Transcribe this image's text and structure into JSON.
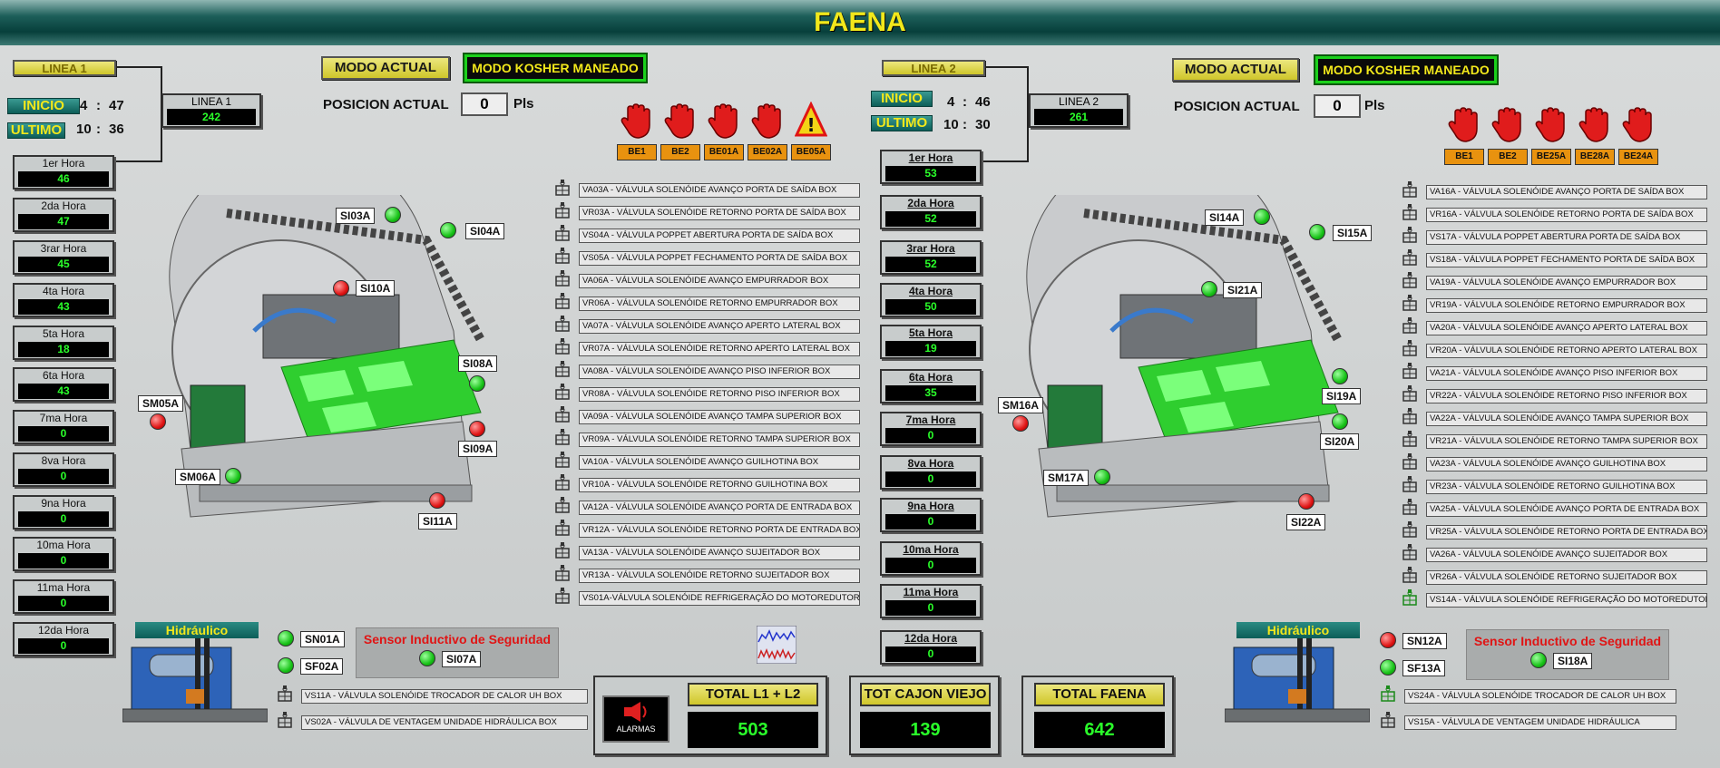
{
  "header": {
    "title": "FAENA"
  },
  "line1": {
    "tag": "LINEA 1",
    "inicio_label": "INICIO",
    "inicio_h": "4",
    "inicio_m": "47",
    "ultimo_label": "ULTIMO",
    "ultimo_h": "10",
    "ultimo_m": "36",
    "linebox": {
      "label": "LINEA 1",
      "value": "242"
    },
    "mode_label": "MODO ACTUAL",
    "mode_value": "MODO KOSHER MANEADO",
    "pos_label": "POSICION ACTUAL",
    "pos_value": "0",
    "pos_unit": "Pls",
    "be_buttons": [
      "BE1",
      "BE2",
      "BE01A",
      "BE02A",
      "BE05A"
    ],
    "hours": [
      {
        "label": "1er Hora",
        "value": "46"
      },
      {
        "label": "2da Hora",
        "value": "47"
      },
      {
        "label": "3rar Hora",
        "value": "45"
      },
      {
        "label": "4ta Hora",
        "value": "43"
      },
      {
        "label": "5ta Hora",
        "value": "18"
      },
      {
        "label": "6ta Hora",
        "value": "43"
      },
      {
        "label": "7ma  Hora",
        "value": "0"
      },
      {
        "label": "8va Hora",
        "value": "0"
      },
      {
        "label": "9na Hora",
        "value": "0"
      },
      {
        "label": "10ma Hora",
        "value": "0"
      },
      {
        "label": "11ma Hora",
        "value": "0"
      },
      {
        "label": "12da Hora",
        "value": "0"
      }
    ],
    "sensors": {
      "si03a": "SI03A",
      "si04a": "SI04A",
      "si10a": "SI10A",
      "si08a": "SI08A",
      "sm05a": "SM05A",
      "si09a": "SI09A",
      "sm06a": "SM06A",
      "si11a": "SI11A"
    },
    "valves": [
      "VA03A - VÁLVULA SOLENÓIDE AVANÇO PORTA DE SAÍDA BOX",
      "VR03A - VÁLVULA SOLENÓIDE RETORNO PORTA DE SAÍDA BOX",
      "VS04A - VÁLVULA POPPET ABERTURA PORTA DE SAÍDA BOX",
      "VS05A - VÁLVULA POPPET FECHAMENTO PORTA DE SAÍDA BOX",
      "VA06A - VÁLVULA SOLENÓIDE AVANÇO EMPURRADOR BOX",
      "VR06A - VÁLVULA SOLENÓIDE RETORNO EMPURRADOR BOX",
      "VA07A - VÁLVULA SOLENÓIDE AVANÇO APERTO LATERAL BOX",
      "VR07A - VÁLVULA SOLENÓIDE RETORNO APERTO LATERAL BOX",
      "VA08A - VÁLVULA SOLENÓIDE AVANÇO PISO INFERIOR BOX",
      "VR08A - VÁLVULA SOLENÓIDE RETORNO PISO INFERIOR BOX",
      "VA09A - VÁLVULA SOLENÓIDE AVANÇO TAMPA SUPERIOR BOX",
      "VR09A - VÁLVULA SOLENÓIDE RETORNO TAMPA SUPERIOR BOX",
      "VA10A - VÁLVULA SOLENÓIDE AVANÇO GUILHOTINA BOX",
      "VR10A - VÁLVULA SOLENÓIDE RETORNO GUILHOTINA BOX",
      "VA12A - VÁLVULA SOLENÓIDE AVANÇO PORTA DE ENTRADA BOX",
      "VR12A - VÁLVULA SOLENÓIDE RETORNO PORTA DE ENTRADA BOX",
      "VA13A - VÁLVULA SOLENÓIDE AVANÇO SUJEITADOR BOX",
      "VR13A - VÁLVULA SOLENÓIDE RETORNO SUJEITADOR BOX",
      "VS01A-VÁLVULA SOLENÓIDE REFRIGERAÇÃO DO MOTOREDUTOR"
    ],
    "hydro": {
      "title": "Hidráulico",
      "sn": "SN01A",
      "sf": "SF02A",
      "safety_title": "Sensor Inductivo de Seguridad",
      "safety_tag": "SI07A",
      "valves": [
        "VS11A - VÁLVULA SOLENÓIDE TROCADOR DE CALOR UH BOX",
        "VS02A - VÁLVULA DE VENTAGEM UNIDADE HIDRÁULICA BOX"
      ]
    }
  },
  "line2": {
    "tag": "LINEA 2",
    "inicio_label": "INICIO",
    "inicio_h": "4",
    "inicio_m": "46",
    "ultimo_label": "ULTIMO",
    "ultimo_h": "10",
    "ultimo_m": "30",
    "linebox": {
      "label": "LINEA 2",
      "value": "261"
    },
    "mode_label": "MODO ACTUAL",
    "mode_value": "MODO KOSHER MANEADO",
    "pos_label": "POSICION ACTUAL",
    "pos_value": "0",
    "pos_unit": "Pls",
    "be_buttons": [
      "BE1",
      "BE2",
      "BE25A",
      "BE28A",
      "BE24A"
    ],
    "hours": [
      {
        "label": "1er Hora",
        "value": "53"
      },
      {
        "label": "2da Hora",
        "value": "52"
      },
      {
        "label": "3rar Hora",
        "value": "52"
      },
      {
        "label": "4ta Hora",
        "value": "50"
      },
      {
        "label": "5ta Hora",
        "value": "19"
      },
      {
        "label": "6ta Hora",
        "value": "35"
      },
      {
        "label": "7ma  Hora",
        "value": "0"
      },
      {
        "label": "8va Hora",
        "value": "0"
      },
      {
        "label": "9na Hora",
        "value": "0"
      },
      {
        "label": "10ma Hora",
        "value": "0"
      },
      {
        "label": "11ma Hora",
        "value": "0"
      },
      {
        "label": "12da Hora",
        "value": "0"
      }
    ],
    "sensors": {
      "si14a": "SI14A",
      "si15a": "SI15A",
      "si21a": "SI21A",
      "si19a": "SI19A",
      "sm16a": "SM16A",
      "si20a": "SI20A",
      "sm17a": "SM17A",
      "si22a": "SI22A"
    },
    "valves": [
      "VA16A - VÁLVULA SOLENÓIDE AVANÇO PORTA DE SAÍDA BOX",
      "VR16A - VÁLVULA SOLENÓIDE RETORNO PORTA DE SAÍDA BOX",
      "VS17A - VÁLVULA POPPET ABERTURA PORTA DE SAÍDA BOX",
      "VS18A - VÁLVULA POPPET FECHAMENTO PORTA DE SAÍDA BOX",
      "VA19A - VÁLVULA SOLENÓIDE AVANÇO EMPURRADOR BOX",
      "VR19A - VÁLVULA SOLENÓIDE RETORNO EMPURRADOR BOX",
      "VA20A - VÁLVULA SOLENÓIDE AVANÇO APERTO LATERAL BOX",
      "VR20A - VÁLVULA SOLENÓIDE RETORNO APERTO LATERAL BOX",
      "VA21A - VÁLVULA SOLENÓIDE AVANÇO PISO INFERIOR BOX",
      "VR22A - VÁLVULA SOLENÓIDE RETORNO PISO INFERIOR BOX",
      "VA22A - VÁLVULA SOLENÓIDE AVANÇO TAMPA SUPERIOR BOX",
      "VR21A - VÁLVULA SOLENÓIDE RETORNO TAMPA SUPERIOR BOX",
      "VA23A - VÁLVULA SOLENÓIDE AVANÇO GUILHOTINA BOX",
      "VR23A - VÁLVULA SOLENÓIDE RETORNO GUILHOTINA BOX",
      "VA25A - VÁLVULA SOLENÓIDE AVANÇO PORTA DE ENTRADA BOX",
      "VR25A - VÁLVULA SOLENÓIDE RETORNO PORTA DE ENTRADA BOX",
      "VA26A - VÁLVULA SOLENÓIDE AVANÇO SUJEITADOR BOX",
      "VR26A - VÁLVULA SOLENÓIDE RETORNO SUJEITADOR BOX",
      "VS14A - VÁLVULA SOLENÓIDE REFRIGERAÇÃO DO MOTOREDUTOR"
    ],
    "hydro": {
      "title": "Hidráulico",
      "sn": "SN12A",
      "sf": "SF13A",
      "safety_title": "Sensor Inductivo de Seguridad",
      "safety_tag": "SI18A",
      "valves": [
        "VS24A - VÁLVULA SOLENÓIDE TROCADOR DE CALOR UH BOX",
        "VS15A - VÁLVULA DE VENTAGEM UNIDADE HIDRÁULICA"
      ]
    }
  },
  "totals": {
    "alarm_label": "ALARMAS",
    "l1l2_label": "TOTAL L1 + L2",
    "l1l2_value": "503",
    "cajon_label": "TOT CAJON VIEJO",
    "cajon_value": "139",
    "faena_label": "TOTAL FAENA",
    "faena_value": "642"
  },
  "colors": {
    "accent_yellow": "#f2e81b",
    "value_green": "#2aff2a",
    "led_green": "#17c217",
    "led_red": "#e01414",
    "be_orange": "#e8920f",
    "header_teal": "#0c5e58"
  }
}
